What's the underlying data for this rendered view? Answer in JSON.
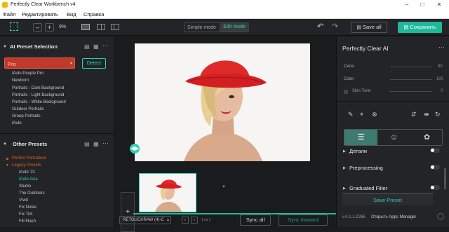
{
  "window": {
    "title": "Perfectly Clear Workbench v4"
  },
  "menu": [
    "Файл",
    "Редактировать",
    "Вид",
    "Справка"
  ],
  "toolbar": {
    "zoom": "9%",
    "mode_simple": "Simple mode",
    "mode_edit": "Edit mode",
    "save_all": "Save all",
    "save": "Сохранить"
  },
  "left": {
    "ai_title": "AI Preset Selection",
    "preset_selected": "Pro",
    "detect_button": "Detect",
    "ai_items": [
      "iAuto People Pro",
      "Newborn",
      "Portraits - Dark Background",
      "Portraits - Light Background",
      "Portraits - White Background",
      "Outdoor Portraits",
      "Group Portraits",
      "iAuto"
    ],
    "other_title": "Other Presets",
    "groups": [
      "Perfect Portraiture",
      "Legacy Presets"
    ],
    "legacy_items": [
      "iAuto '21",
      "iAuto Asia",
      "Studio",
      "The Outdoors",
      "Vivid",
      "Fix Noise",
      "Fix Tint",
      "Fill Flash"
    ]
  },
  "center": {
    "filter_select": "RETOUCHRAW (4)-C",
    "page_info": "1 из 1",
    "sync_all": "Sync all",
    "sync_forward": "Sync forward",
    "add_label": "+"
  },
  "right": {
    "title": "Perfectly Clear AI",
    "sliders": [
      {
        "label": "Сила",
        "value": "80"
      },
      {
        "label": "Color",
        "value": "100"
      },
      {
        "label": "Skin Tone",
        "value": "0"
      }
    ],
    "sections": [
      "Детали",
      "Preprocessing",
      "Graduated Fliter"
    ],
    "save_preset": "Save Preset",
    "version": "v.4.1.1.2266",
    "apps_manager": "Открыть Apps Manager"
  },
  "colors": {
    "accent": "#2ad1b1",
    "preset_red": "#c0392b",
    "orange": "#e2631f"
  }
}
